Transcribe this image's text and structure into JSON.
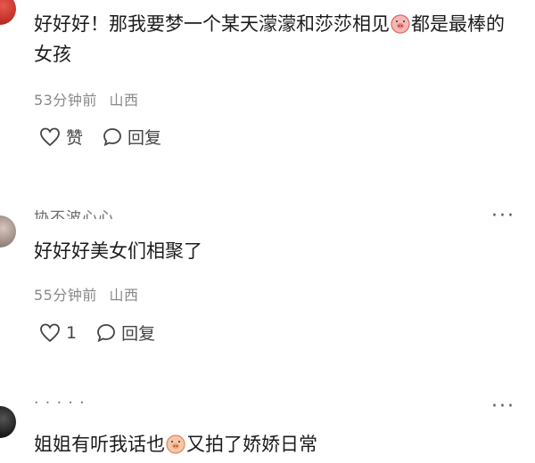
{
  "comments": [
    {
      "text_before": "好好好！那我要梦一个某天濛濛和莎莎相见",
      "text_after": "都是最棒的女孩",
      "time": "53分钟前",
      "location": "山西",
      "like_label": "赞",
      "reply_label": "回复"
    },
    {
      "name_partial": "协不波心心",
      "text": "好好好美女们相聚了",
      "time": "55分钟前",
      "location": "山西",
      "like_count": "1",
      "reply_label": "回复"
    },
    {
      "name_partial": "· · · · ·",
      "text_before": "姐姐有听我话也",
      "text_after": "又拍了娇娇日常"
    }
  ],
  "more_label": "···",
  "colors": {
    "text": "#1c1c1c",
    "meta": "#888888",
    "icon": "#444444"
  }
}
